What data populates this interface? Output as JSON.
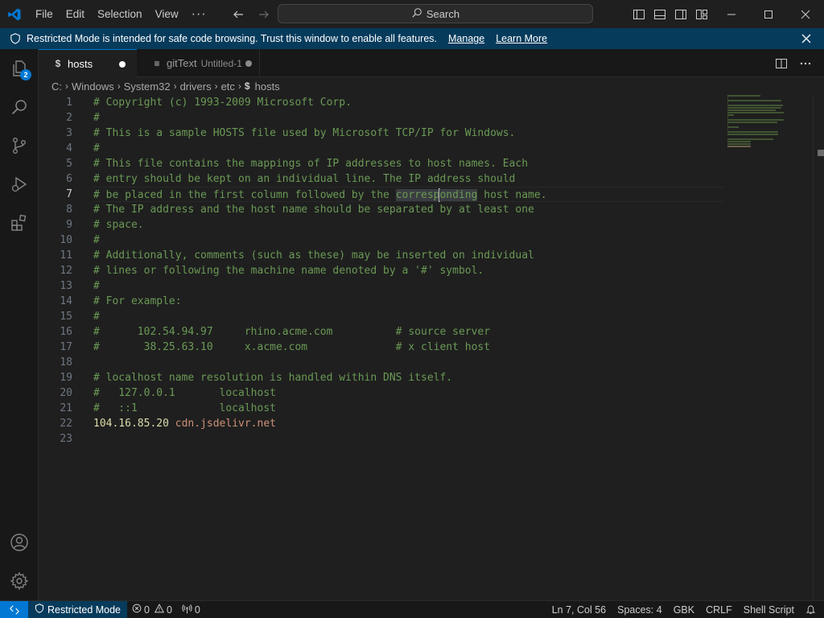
{
  "menu": {
    "file": "File",
    "edit": "Edit",
    "selection": "Selection",
    "view": "View",
    "more": "···"
  },
  "search": {
    "label": "Search"
  },
  "banner": {
    "text": "Restricted Mode is intended for safe code browsing. Trust this window to enable all features.",
    "manage": "Manage",
    "learn_more": "Learn More"
  },
  "activity": {
    "explorer_badge": "2"
  },
  "tabs": [
    {
      "label": "hosts",
      "icon": "$"
    },
    {
      "label": "gitText",
      "description": "Untitled-1",
      "icon": "≡"
    }
  ],
  "breadcrumb": {
    "items": [
      "C:",
      "Windows",
      "System32",
      "drivers",
      "etc"
    ],
    "file": "hosts",
    "file_icon": "$"
  },
  "editor": {
    "line_numbers": [
      "1",
      "2",
      "3",
      "4",
      "5",
      "6",
      "7",
      "8",
      "9",
      "10",
      "11",
      "12",
      "13",
      "14",
      "15",
      "16",
      "17",
      "18",
      "19",
      "20",
      "21",
      "22",
      "23"
    ],
    "lines": [
      "# Copyright (c) 1993-2009 Microsoft Corp.",
      "#",
      "# This is a sample HOSTS file used by Microsoft TCP/IP for Windows.",
      "#",
      "# This file contains the mappings of IP addresses to host names. Each",
      "# entry should be kept on an individual line. The IP address should",
      "",
      "# The IP address and the host name should be separated by at least one",
      "# space.",
      "#",
      "# Additionally, comments (such as these) may be inserted on individual",
      "# lines or following the machine name denoted by a '#' symbol.",
      "#",
      "# For example:",
      "#",
      "#      102.54.94.97     rhino.acme.com          # source server",
      "#       38.25.63.10     x.acme.com              # x client host",
      "",
      "# localhost name resolution is handled within DNS itself.",
      "#   127.0.0.1       localhost",
      "#   ::1             localhost",
      "",
      ""
    ],
    "line7": {
      "before": "# be placed in the first column followed by the ",
      "hl_a": "corresp",
      "hl_b": "onding",
      "after": " host name."
    },
    "line22": {
      "ip": "104.16.85.20",
      "host": "cdn.jsdelivr.net"
    }
  },
  "status": {
    "restricted": "Restricted Mode",
    "errors": "0",
    "warnings": "0",
    "ports": "0",
    "position": "Ln 7, Col 56",
    "spaces": "Spaces: 4",
    "encoding": "GBK",
    "eol": "CRLF",
    "language": "Shell Script"
  },
  "colors": {
    "accent": "#0078d4",
    "banner": "#063b5c",
    "comment": "#6a9955",
    "ip": "#dcdcaa",
    "host": "#ce9178"
  }
}
